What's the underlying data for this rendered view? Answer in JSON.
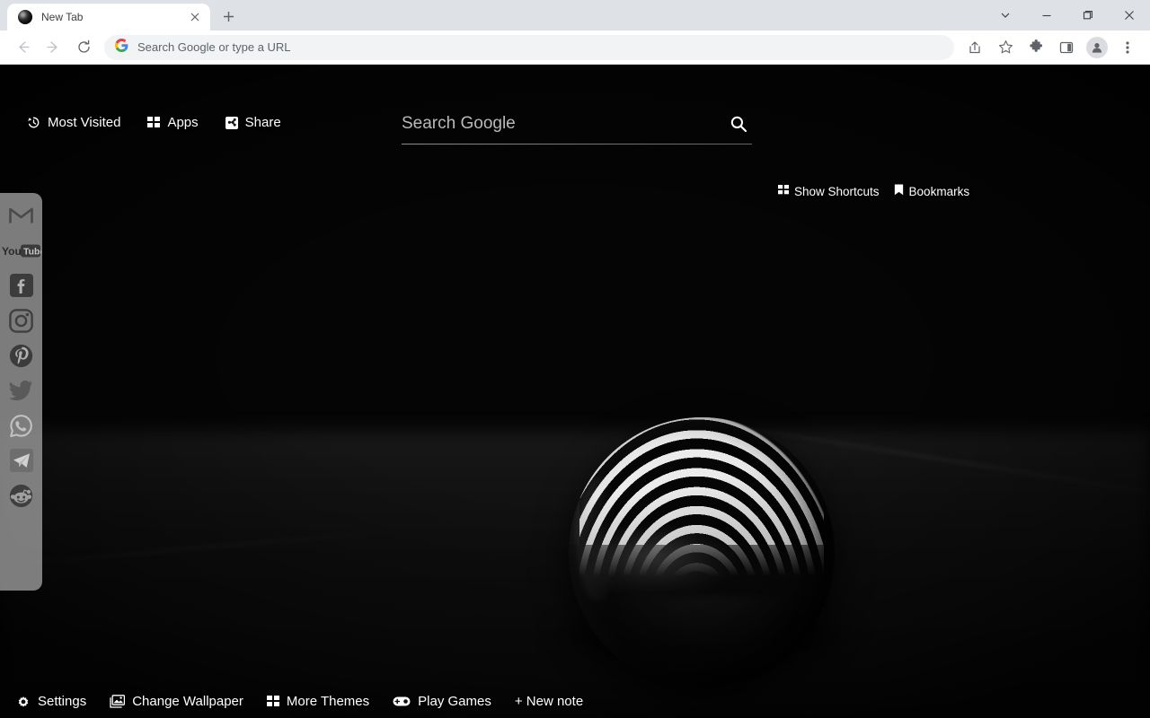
{
  "browser": {
    "tab": {
      "title": "New Tab",
      "favicon": "sphere-favicon",
      "close_label": "×"
    },
    "new_tab_button": "+",
    "window_controls": [
      {
        "name": "minimize-to-tray-chevron",
        "glyph": "chevron-down-icon"
      },
      {
        "name": "minimize",
        "glyph": "minimize-icon"
      },
      {
        "name": "maximize",
        "glyph": "maximize-icon"
      },
      {
        "name": "close",
        "glyph": "close-icon"
      }
    ],
    "toolbar": {
      "back": "back-arrow-icon",
      "forward": "forward-arrow-icon",
      "reload": "reload-icon",
      "omnibox_placeholder": "Search Google or type a URL",
      "omnibox_value": "",
      "site_icon": "google-g-icon",
      "share": "share-icon",
      "bookmark": "star-icon",
      "extensions": "puzzle-piece-icon",
      "side_panel": "side-panel-icon",
      "profile": "profile-avatar-icon",
      "menu": "three-dot-menu-icon"
    }
  },
  "ntp": {
    "top_nav": [
      {
        "label": "Most Visited",
        "icon": "history-icon"
      },
      {
        "label": "Apps",
        "icon": "grid-icon"
      },
      {
        "label": "Share",
        "icon": "share-icon"
      }
    ],
    "search": {
      "placeholder": "Search Google",
      "value": "",
      "button_icon": "search-icon"
    },
    "right_links": [
      {
        "label": "Show Shortcuts",
        "icon": "grid-icon"
      },
      {
        "label": "Bookmarks",
        "icon": "bookmark-icon"
      }
    ],
    "social_sidebar": [
      {
        "name": "gmail",
        "label": "Gmail"
      },
      {
        "name": "youtube",
        "label": "YouTube"
      },
      {
        "name": "facebook",
        "label": "Facebook"
      },
      {
        "name": "instagram",
        "label": "Instagram"
      },
      {
        "name": "pinterest",
        "label": "Pinterest"
      },
      {
        "name": "twitter",
        "label": "Twitter"
      },
      {
        "name": "whatsapp",
        "label": "WhatsApp"
      },
      {
        "name": "telegram",
        "label": "Telegram"
      },
      {
        "name": "reddit",
        "label": "Reddit"
      }
    ],
    "bottom_bar": [
      {
        "label": "Settings",
        "icon": "gear-icon"
      },
      {
        "label": "Change Wallpaper",
        "icon": "image-icon"
      },
      {
        "label": "More Themes",
        "icon": "grid-icon"
      },
      {
        "label": "Play Games",
        "icon": "gamepad-icon"
      },
      {
        "label": "+ New note",
        "icon": "none"
      }
    ],
    "wallpaper": {
      "description": "black-and-white photograph of a glossy black sphere reflecting concentric striped arcs, blurred vertical light bands in background"
    }
  },
  "colors": {
    "tabstrip_bg": "#dee1e6",
    "toolbar_bg": "#ffffff",
    "omnibox_bg": "#f1f3f4",
    "ntp_bg": "#050505",
    "ntp_text": "#ffffff",
    "social_panel_bg": "#acacac"
  }
}
